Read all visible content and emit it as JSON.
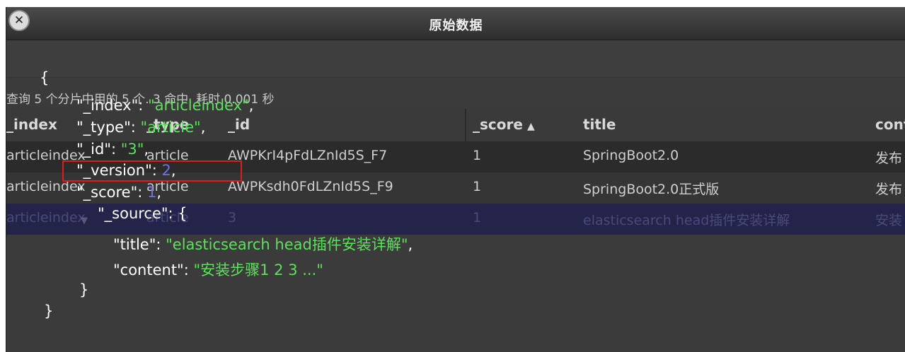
{
  "dialog": {
    "title": "原始数据",
    "close_icon": "close-icon"
  },
  "results": {
    "summary": "查询 5 个分片中用的 5 个. 3 命中. 耗时 0.001 秒",
    "columns": [
      "_index",
      "_type",
      "_id",
      "_score",
      "title",
      "content"
    ],
    "sort_indicator": "▲",
    "rows": [
      {
        "index": "articleindex",
        "type": "article",
        "id": "AWPKrI4pFdLZnId5S_F7",
        "score": "1",
        "title": "SpringBoot2.0",
        "content": "发布"
      },
      {
        "index": "articleindex",
        "type": "article",
        "id": "AWPKsdh0FdLZnId5S_F9",
        "score": "1",
        "title": "SpringBoot2.0正式版",
        "content": "发布"
      },
      {
        "index": "articleindex",
        "type": "article",
        "id": "3",
        "score": "1",
        "title": "elasticsearch head插件安装详解",
        "content": "安装"
      }
    ]
  },
  "json_view": {
    "open_brace": "{",
    "index_key": "\"_index\": ",
    "index_val": "\"articleindex\"",
    "type_key": "\"_type\": ",
    "type_val": "\"article\"",
    "id_key": "\"_id\": ",
    "id_val": "\"3\"",
    "version_key": "\"_version\": ",
    "version_val": "2",
    "score_key": "\"_score\": ",
    "score_val": "1",
    "source_key": "\"_source\": {",
    "title_key": "\"title\": ",
    "title_val": "\"elasticsearch head插件安装详解\"",
    "content_key": "\"content\": ",
    "content_val": "\"安装步骤1 2 3 ...\"",
    "inner_close": "}",
    "outer_close": "}",
    "comma": ","
  },
  "colors": {
    "string": "#5ee05e",
    "number": "#6f6fe8",
    "highlight": "#d62020",
    "selected_row": "#24244a"
  }
}
